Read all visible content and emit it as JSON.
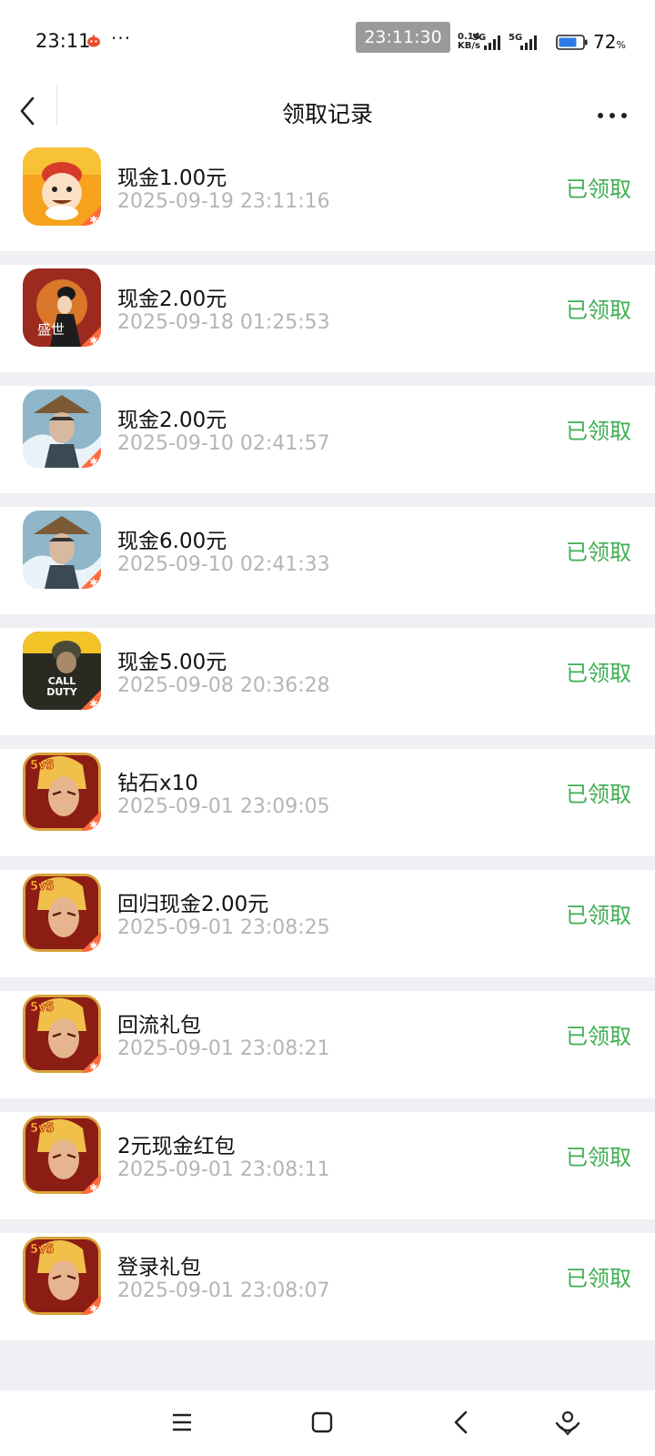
{
  "status_bar": {
    "time": "23:11",
    "clock_overlay": "23:11:30",
    "net_speed_value": "0.14",
    "net_speed_unit": "KB/s",
    "network_1": "5G",
    "network_2": "5G",
    "battery_percent": "72",
    "battery_unit": "%"
  },
  "header": {
    "title": "领取记录"
  },
  "colors": {
    "status_green": "#3fae52",
    "timestamp_gray": "#b5b5b5",
    "background": "#efeff4"
  },
  "records": [
    {
      "icon": "cartoon-farmer-game-icon",
      "name": "现金1.00元",
      "time": "2025-09-19 23:11:16",
      "status": "已领取"
    },
    {
      "icon": "palace-lady-game-icon",
      "name": "现金2.00元",
      "time": "2025-09-18 01:25:53",
      "status": "已领取"
    },
    {
      "icon": "hat-warrior-game-icon",
      "name": "现金2.00元",
      "time": "2025-09-10 02:41:57",
      "status": "已领取"
    },
    {
      "icon": "hat-warrior-game-icon",
      "name": "现金6.00元",
      "time": "2025-09-10 02:41:33",
      "status": "已领取"
    },
    {
      "icon": "soldier-shooter-game-icon",
      "name": "现金5.00元",
      "time": "2025-09-08 20:36:28",
      "status": "已领取"
    },
    {
      "icon": "5v5-hero-game-icon",
      "name": "钻石x10",
      "time": "2025-09-01 23:09:05",
      "status": "已领取"
    },
    {
      "icon": "5v5-hero-game-icon",
      "name": "回归现金2.00元",
      "time": "2025-09-01 23:08:25",
      "status": "已领取"
    },
    {
      "icon": "5v5-hero-game-icon",
      "name": "回流礼包",
      "time": "2025-09-01 23:08:21",
      "status": "已领取"
    },
    {
      "icon": "5v5-hero-game-icon",
      "name": "2元现金红包",
      "time": "2025-09-01 23:08:11",
      "status": "已领取"
    },
    {
      "icon": "5v5-hero-game-icon",
      "name": "登录礼包",
      "time": "2025-09-01 23:08:07",
      "status": "已领取"
    }
  ],
  "icon_badges": {
    "soldier_logo_line1": "CALL",
    "soldier_logo_line2": "DUTY",
    "hero_badge": "5v5",
    "palace_text": "盛世"
  }
}
